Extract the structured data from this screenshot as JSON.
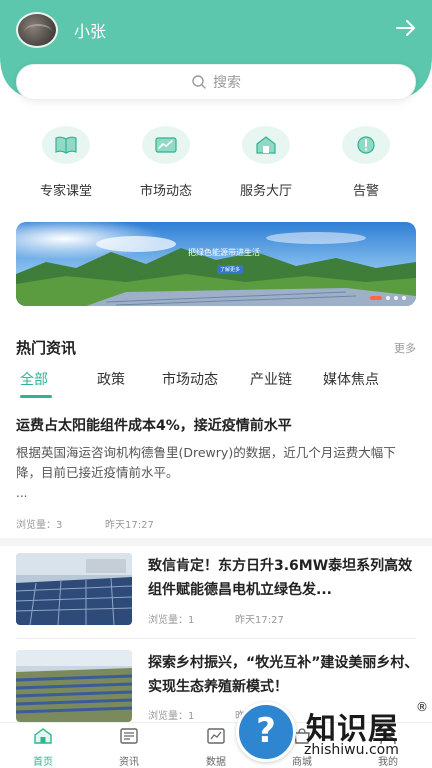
{
  "header": {
    "username": "小张"
  },
  "search": {
    "placeholder": "搜索"
  },
  "entries": [
    {
      "label": "专家课堂",
      "icon": "book-icon"
    },
    {
      "label": "市场动态",
      "icon": "chart-icon"
    },
    {
      "label": "服务大厅",
      "icon": "house-icon"
    },
    {
      "label": "告警",
      "icon": "alert-icon"
    }
  ],
  "banner": {
    "title": "把绿色能源带进生活",
    "tag": "了解更多"
  },
  "news": {
    "title": "热门资讯",
    "more": "更多",
    "tabs": [
      "全部",
      "政策",
      "市场动态",
      "产业链",
      "媒体焦点"
    ],
    "active_tab": "全部"
  },
  "articles": [
    {
      "title": "运费占太阳能组件成本4%，接近疫情前水平",
      "body": "根据英国海运咨询机构德鲁里(Drewry)的数据，近几个月运费大幅下降，目前已接近疫情前水平。",
      "ellipsis": "...",
      "views": "浏览量：3",
      "time": "昨天17:27"
    },
    {
      "title": "致信肯定！东方日升3.6MW泰坦系列高效组件赋能德昌电机立绿色发...",
      "views": "浏览量：1",
      "time": "昨天17:27"
    },
    {
      "title": "探索乡村振兴，“牧光互补”建设美丽乡村、实现生态养殖新模式！",
      "views": "浏览量：1",
      "time": "昨"
    }
  ],
  "bottom_nav": [
    {
      "label": "首页",
      "active": true
    },
    {
      "label": "资讯",
      "active": false
    },
    {
      "label": "数据",
      "active": false
    },
    {
      "label": "商城",
      "active": false
    },
    {
      "label": "我的",
      "active": false
    }
  ],
  "watermark": {
    "name": "知识屋",
    "url": "zhishiwu.com",
    "reg": "®",
    "q": "?"
  },
  "colors": {
    "accent": "#2fb493",
    "header": "#5cc7ad"
  }
}
